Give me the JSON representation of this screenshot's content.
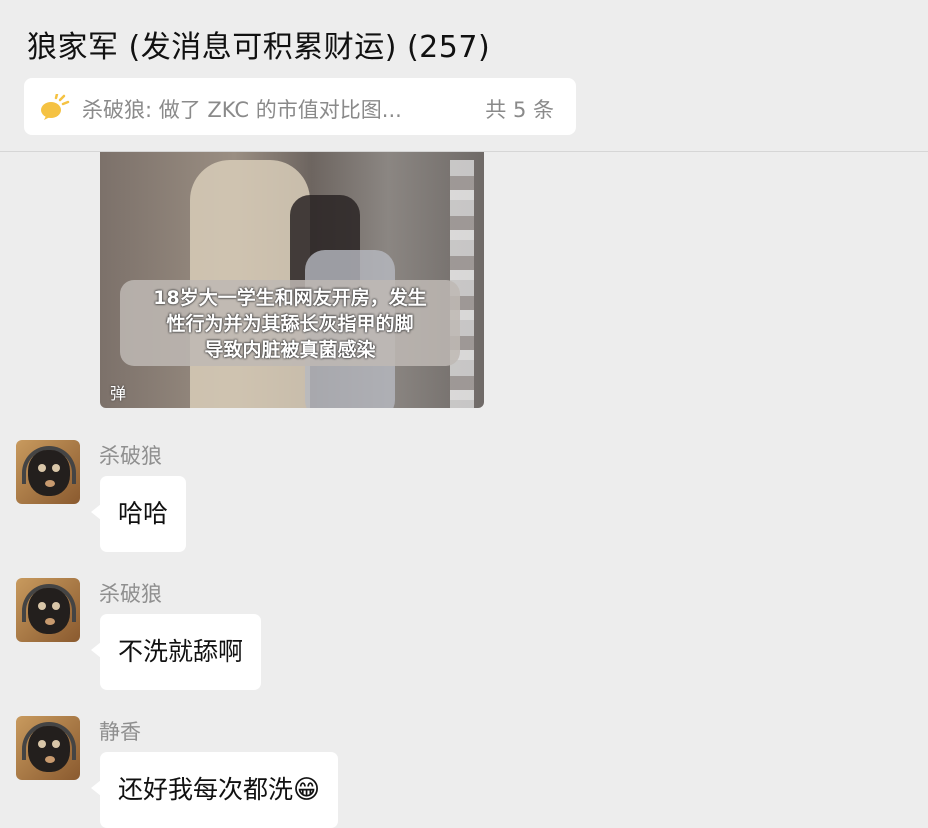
{
  "header": {
    "title": "狼家军 (发消息可积累财运) (257)"
  },
  "pinned": {
    "icon": "announcement-icon",
    "text": "杀破狼: 做了 ZKC 的市值对比图...",
    "count": "共 5 条"
  },
  "video_message": {
    "caption_lines": [
      "18岁大一学生和网友开房，发生",
      "性行为并为其舔长灰指甲的脚",
      "导致内脏被真菌感染"
    ],
    "danmu_label": "弹"
  },
  "messages": [
    {
      "sender": "杀破狼",
      "text": "哈哈"
    },
    {
      "sender": "杀破狼",
      "text": "不洗就舔啊"
    },
    {
      "sender": "静香",
      "text": "还好我每次都洗",
      "emoji": "😁"
    }
  ],
  "colors": {
    "background": "#ededed",
    "bubble": "#ffffff",
    "pin_icon": "#f5c242"
  }
}
